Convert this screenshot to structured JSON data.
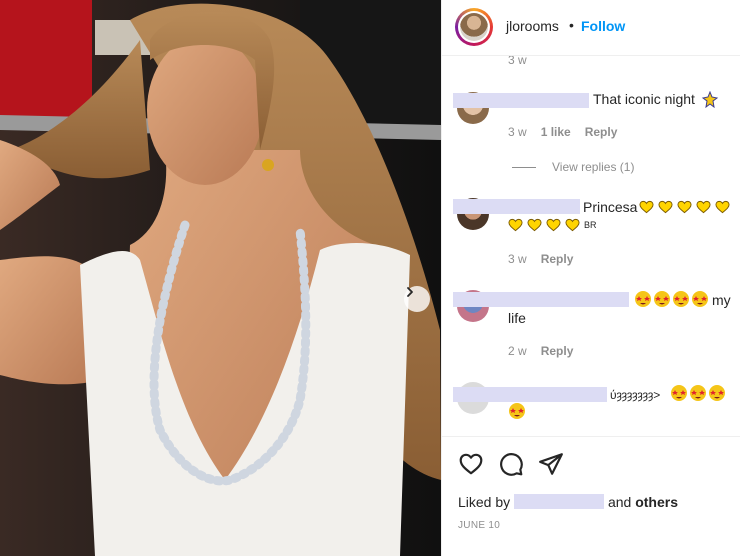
{
  "post": {
    "username": "jlorooms",
    "separator": "•",
    "follow_label": "Follow"
  },
  "comments": [
    {
      "text": "That iconic night",
      "time": "3 w",
      "likes": "1 like",
      "reply": "Reply",
      "view_replies": "View replies (1)"
    },
    {
      "text": "Princesa",
      "suffix": "BR",
      "time": "3 w",
      "reply": "Reply"
    },
    {
      "text_suffix": "my",
      "text_line2": "life",
      "time": "2 w",
      "reply": "Reply"
    },
    {
      "text": "ύȝȝȝȝȝȝȝ>",
      "time": "",
      "reply": ""
    }
  ],
  "top_cut_text": "3 w",
  "likes": {
    "prefix": "Liked by",
    "suffix_plain": "and",
    "suffix_bold": "others"
  },
  "date": "JUNE 10",
  "colors": {
    "follow": "#0095f6",
    "redaction": "#dcdcf4",
    "muted": "#8e8e8e"
  },
  "icons": [
    "heart-icon",
    "comment-icon",
    "share-icon",
    "chevron-right-icon"
  ]
}
